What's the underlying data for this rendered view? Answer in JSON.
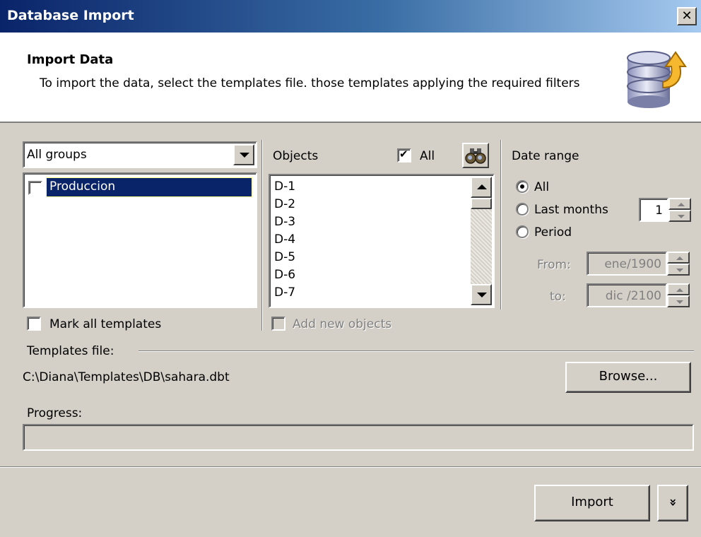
{
  "window": {
    "title": "Database Import",
    "close_glyph": "✕"
  },
  "header": {
    "title": "Import Data",
    "description": "To import the data, select the templates file. those templates applying the required filters",
    "icon": "database-import-icon"
  },
  "groups": {
    "selected_group": "All groups",
    "items": [
      {
        "label": "Produccion",
        "checked": false,
        "selected": true
      }
    ],
    "mark_all_label": "Mark all templates",
    "mark_all_checked": false
  },
  "objects": {
    "header_label": "Objects",
    "all_label": "All",
    "all_checked": true,
    "find_icon": "binoculars-icon",
    "items": [
      "D-1",
      "D-2",
      "D-3",
      "D-4",
      "D-5",
      "D-6",
      "D-7"
    ],
    "add_new_label": "Add new objects",
    "add_new_checked": false,
    "add_new_enabled": false
  },
  "date_range": {
    "label": "Date range",
    "options": [
      "All",
      "Last months",
      "Period"
    ],
    "selected_option": "All",
    "last_months_value": "1",
    "from_label": "From:",
    "from_value": "ene/1900",
    "to_label": "to:",
    "to_value": "dic /2100"
  },
  "templates_file": {
    "label": "Templates file:",
    "path": "C:\\Diana\\Templates\\DB\\sahara.dbt",
    "browse_label": "Browse..."
  },
  "progress": {
    "label": "Progress:",
    "value": 0
  },
  "footer": {
    "import_label": "Import",
    "more_glyph": "»"
  },
  "colors": {
    "titlebar_start": "#0a246a",
    "titlebar_end": "#a6caf0",
    "face": "#d4d0c8",
    "selection": "#0a246a"
  }
}
